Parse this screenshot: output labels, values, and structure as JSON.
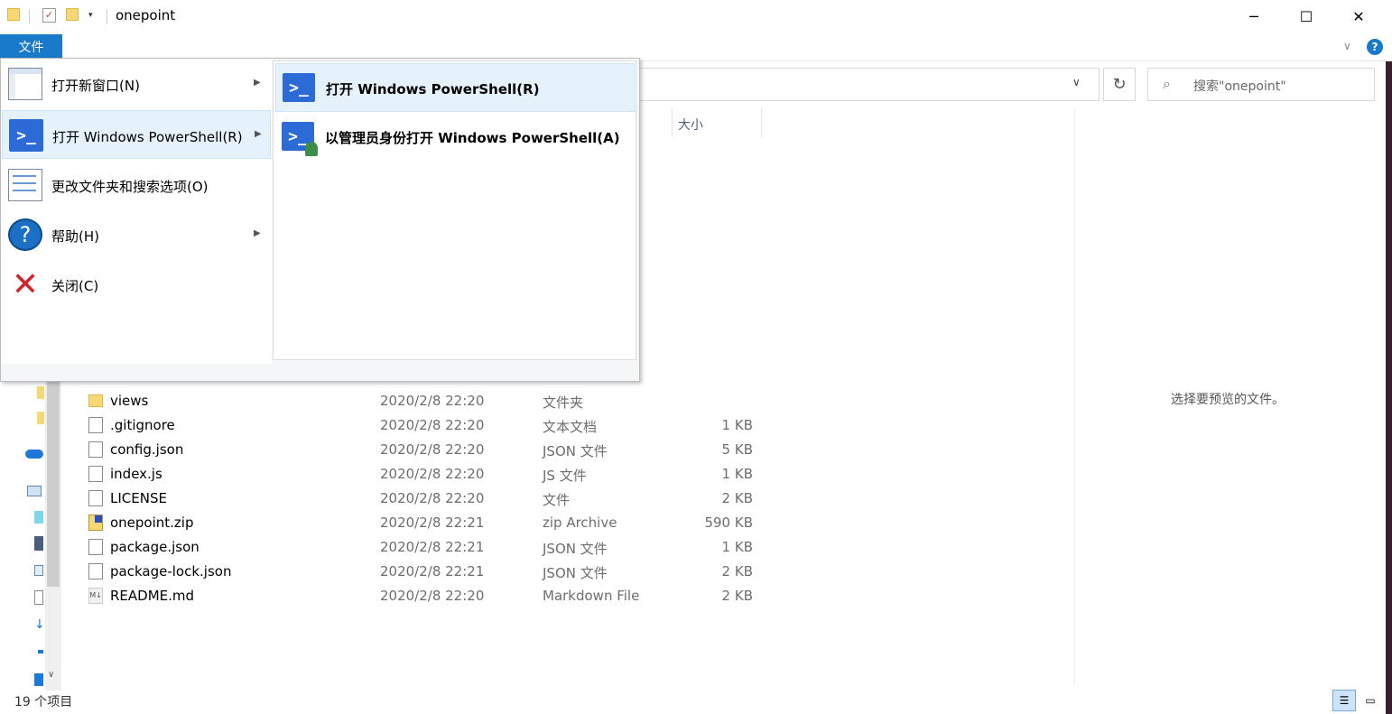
{
  "window": {
    "title": "onepoint",
    "minimize": "─",
    "maximize": "☐",
    "close": "✕"
  },
  "ribbon": {
    "file_tab": "文件",
    "help": "?"
  },
  "address": {
    "refresh": "↻"
  },
  "search": {
    "placeholder": "搜索\"onepoint\""
  },
  "columns": {
    "size": "大小"
  },
  "files": [
    {
      "name": "views",
      "date": "2020/2/8 22:20",
      "type": "文件夹",
      "size": "",
      "icon": "folder"
    },
    {
      "name": ".gitignore",
      "date": "2020/2/8 22:20",
      "type": "文本文档",
      "size": "1 KB",
      "icon": "file"
    },
    {
      "name": "config.json",
      "date": "2020/2/8 22:20",
      "type": "JSON 文件",
      "size": "5 KB",
      "icon": "file"
    },
    {
      "name": "index.js",
      "date": "2020/2/8 22:20",
      "type": "JS 文件",
      "size": "1 KB",
      "icon": "file"
    },
    {
      "name": "LICENSE",
      "date": "2020/2/8 22:20",
      "type": "文件",
      "size": "2 KB",
      "icon": "file"
    },
    {
      "name": "onepoint.zip",
      "date": "2020/2/8 22:21",
      "type": "zip Archive",
      "size": "590 KB",
      "icon": "zip"
    },
    {
      "name": "package.json",
      "date": "2020/2/8 22:21",
      "type": "JSON 文件",
      "size": "1 KB",
      "icon": "file"
    },
    {
      "name": "package-lock.json",
      "date": "2020/2/8 22:21",
      "type": "JSON 文件",
      "size": "2 KB",
      "icon": "file"
    },
    {
      "name": "README.md",
      "date": "2020/2/8 22:20",
      "type": "Markdown File",
      "size": "2 KB",
      "icon": "markdown"
    }
  ],
  "preview": {
    "text": "选择要预览的文件。"
  },
  "status": {
    "count": "19 个项目"
  },
  "file_menu": {
    "items": [
      {
        "label": "打开新窗口(N)"
      },
      {
        "label": "打开 Windows PowerShell(R)"
      },
      {
        "label": "更改文件夹和搜索选项(O)"
      },
      {
        "label": "帮助(H)"
      },
      {
        "label": "关闭(C)"
      }
    ],
    "submenu": [
      {
        "label": "打开 Windows PowerShell(R)"
      },
      {
        "label": "以管理员身份打开 Windows PowerShell(A)"
      }
    ]
  }
}
